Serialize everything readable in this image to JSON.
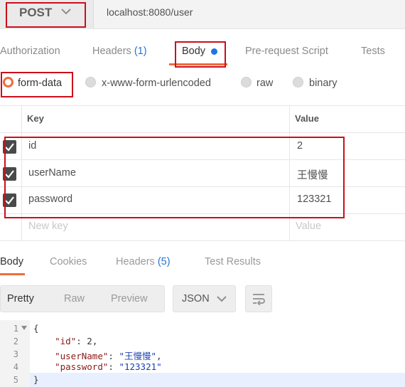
{
  "request": {
    "method": "POST",
    "url": "localhost:8080/user"
  },
  "request_tabs": {
    "authorization": "Authorization",
    "headers": "Headers",
    "headers_count": "(1)",
    "body": "Body",
    "prerequest": "Pre-request Script",
    "tests": "Tests"
  },
  "body_types": {
    "form_data": "form-data",
    "urlencoded": "x-www-form-urlencoded",
    "raw": "raw",
    "binary": "binary",
    "selected": "form-data"
  },
  "params_table": {
    "key_header": "Key",
    "value_header": "Value",
    "rows": [
      {
        "key": "id",
        "value": "2",
        "checked": true
      },
      {
        "key": "userName",
        "value": "王慢慢",
        "checked": true
      },
      {
        "key": "password",
        "value": "123321",
        "checked": true
      }
    ],
    "new_key_placeholder": "New key",
    "new_value_placeholder": "Value"
  },
  "response_tabs": {
    "body": "Body",
    "cookies": "Cookies",
    "headers": "Headers",
    "headers_count": "(5)",
    "test_results": "Test Results"
  },
  "response_toolbar": {
    "pretty": "Pretty",
    "raw": "Raw",
    "preview": "Preview",
    "format": "JSON"
  },
  "response_code": {
    "line_numbers": [
      "1",
      "2",
      "3",
      "4",
      "5"
    ],
    "open_brace": "{",
    "close_brace": "}",
    "id_key": "\"id\"",
    "id_value": "2",
    "username_key": "\"userName\"",
    "username_value": "\"王慢慢\"",
    "password_key": "\"password\"",
    "password_value": "\"123321\""
  },
  "colors": {
    "accent": "#f26b3a",
    "count_blue": "#2a72d6",
    "annotation_red": "#cc0e1b"
  }
}
